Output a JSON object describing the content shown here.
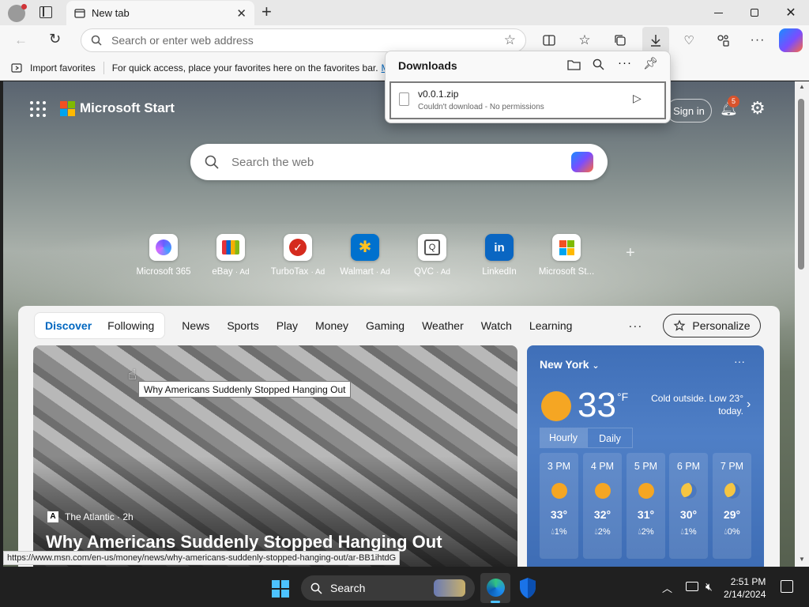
{
  "tab": {
    "title": "New tab"
  },
  "window": {
    "minimize_icon": "minimize-icon",
    "restore_icon": "restore-icon",
    "close_icon": "close-icon"
  },
  "toolbar": {
    "address_placeholder": "Search or enter web address"
  },
  "favorites_bar": {
    "import_label": "Import favorites",
    "hint": "For quick access, place your favorites here on the favorites bar.",
    "hint_link": "M"
  },
  "downloads": {
    "title": "Downloads",
    "file_name": "v0.0.1.zip",
    "file_status": "Couldn't download - No permissions"
  },
  "ms_start": {
    "brand": "Microsoft Start",
    "signin": "Sign in",
    "notifications_count": "5",
    "search_placeholder": "Search the web",
    "sites": [
      {
        "label": "Microsoft 365",
        "ad": ""
      },
      {
        "label": "eBay",
        "ad": "· Ad"
      },
      {
        "label": "TurboTax",
        "ad": "· Ad"
      },
      {
        "label": "Walmart",
        "ad": "· Ad"
      },
      {
        "label": "QVC",
        "ad": "· Ad"
      },
      {
        "label": "LinkedIn",
        "ad": ""
      },
      {
        "label": "Microsoft St...",
        "ad": ""
      }
    ]
  },
  "feed": {
    "tabs": [
      "Discover",
      "Following"
    ],
    "nav": [
      "News",
      "Sports",
      "Play",
      "Money",
      "Gaming",
      "Weather",
      "Watch",
      "Learning"
    ],
    "personalize": "Personalize"
  },
  "story": {
    "source": "The Atlantic",
    "age": "2h",
    "source_line": "The Atlantic · 2h",
    "headline": "Why Americans Suddenly Stopped Hanging Out",
    "tooltip": "Why Americans Suddenly Stopped Hanging Out",
    "status_url": "https://www.msn.com/en-us/money/news/why-americans-suddenly-stopped-hanging-out/ar-BB1ihtdG"
  },
  "weather": {
    "city": "New York",
    "temp": "33",
    "unit": "°F",
    "summary": "Cold outside. Low 23° today.",
    "tab_hourly": "Hourly",
    "tab_daily": "Daily",
    "hours": [
      {
        "time": "3 PM",
        "icon": "sun-icon",
        "temp": "33°",
        "precip": "1%"
      },
      {
        "time": "4 PM",
        "icon": "sun-icon",
        "temp": "32°",
        "precip": "2%"
      },
      {
        "time": "5 PM",
        "icon": "sun-icon",
        "temp": "31°",
        "precip": "2%"
      },
      {
        "time": "6 PM",
        "icon": "moon-icon",
        "temp": "30°",
        "precip": "1%"
      },
      {
        "time": "7 PM",
        "icon": "moon-icon",
        "temp": "29°",
        "precip": "0%"
      }
    ]
  },
  "taskbar": {
    "search_label": "Search",
    "time": "2:51 PM",
    "date": "2/14/2024"
  },
  "colors": {
    "accent": "#0067c0",
    "weather_bg": "#4a78c0",
    "taskbar": "#202020"
  }
}
